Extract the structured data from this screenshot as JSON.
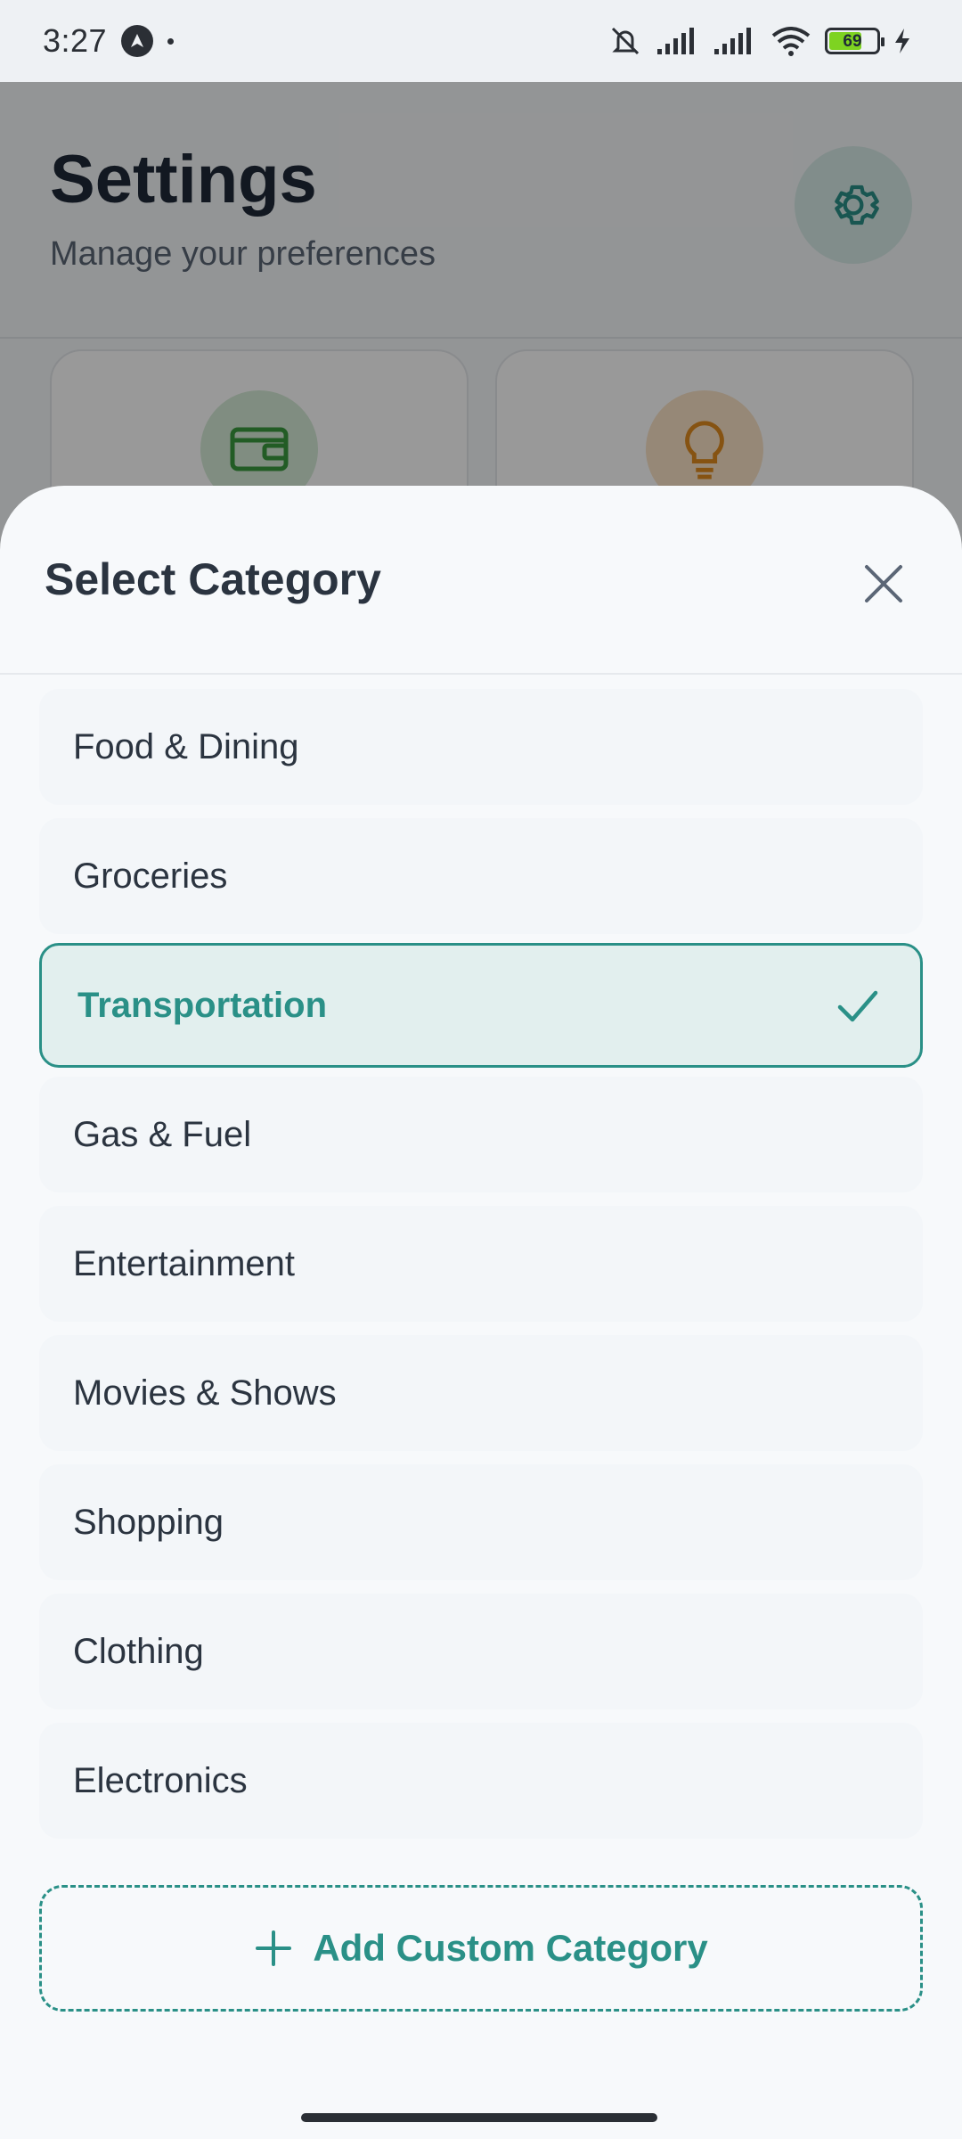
{
  "status_bar": {
    "time": "3:27",
    "battery_level": "69",
    "colors": {
      "battery_fill": "#7ed321"
    }
  },
  "background_page": {
    "title": "Settings",
    "subtitle": "Manage your preferences",
    "cards": [
      {
        "icon": "wallet-icon",
        "color": "#3a9a3e"
      },
      {
        "icon": "lightbulb-icon",
        "color": "#e08a1e"
      }
    ]
  },
  "sheet": {
    "title": "Select Category",
    "close_icon": "close-icon",
    "categories": [
      {
        "label": "Food & Dining",
        "selected": false
      },
      {
        "label": "Groceries",
        "selected": false
      },
      {
        "label": "Transportation",
        "selected": true
      },
      {
        "label": "Gas & Fuel",
        "selected": false
      },
      {
        "label": "Entertainment",
        "selected": false
      },
      {
        "label": "Movies & Shows",
        "selected": false
      },
      {
        "label": "Shopping",
        "selected": false
      },
      {
        "label": "Clothing",
        "selected": false
      },
      {
        "label": "Electronics",
        "selected": false
      }
    ],
    "add_button_label": "Add Custom Category",
    "colors": {
      "accent": "#2a9087"
    }
  }
}
